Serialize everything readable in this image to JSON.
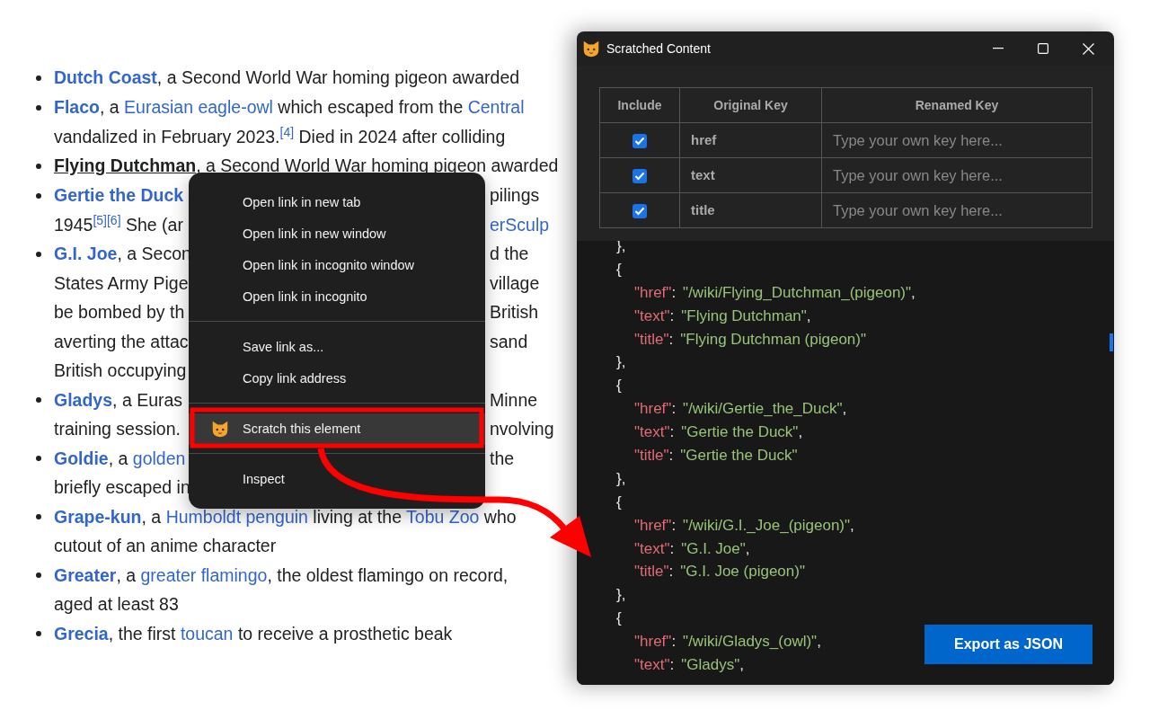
{
  "article": {
    "items": [
      {
        "lines": [
          {
            "segments": [
              {
                "text": "Dutch Coast",
                "kind": "bold_link"
              },
              {
                "text": ", a Second World War homing pigeon awarded",
                "kind": "plain"
              }
            ]
          }
        ]
      },
      {
        "lines": [
          {
            "segments": [
              {
                "text": "Flaco",
                "kind": "bold_link"
              },
              {
                "text": ", a ",
                "kind": "plain"
              },
              {
                "text": "Eurasian eagle-owl",
                "kind": "link"
              },
              {
                "text": " which escaped from the ",
                "kind": "plain"
              },
              {
                "text": "Central",
                "kind": "link"
              }
            ]
          },
          {
            "segments": [
              {
                "text": "vandalized in February 2023.",
                "kind": "plain"
              },
              {
                "text": "[4]",
                "kind": "ref"
              },
              {
                "text": " Died in 2024 after colliding",
                "kind": "plain"
              }
            ]
          }
        ]
      },
      {
        "lines": [
          {
            "segments": [
              {
                "text": "Flying Dutchman",
                "kind": "visited_bold_link"
              },
              {
                "text": ", a Second World War homing pigeon awarded",
                "kind": "plain"
              }
            ]
          }
        ]
      },
      {
        "lines": [
          {
            "segments": [
              {
                "text": "Gertie the Duck",
                "kind": "bold_link"
              }
            ],
            "after_menu": [
              {
                "text": "pilings",
                "kind": "plain"
              }
            ]
          },
          {
            "segments": [
              {
                "text": "1945",
                "kind": "plain"
              },
              {
                "text": "[5][6]",
                "kind": "ref"
              },
              {
                "text": " She (ar",
                "kind": "plain"
              }
            ],
            "after_menu": [
              {
                "text": "erSculp",
                "kind": "link"
              }
            ]
          }
        ]
      },
      {
        "lines": [
          {
            "segments": [
              {
                "text": "G.I. Joe",
                "kind": "bold_link"
              },
              {
                "text": ", a Secon",
                "kind": "plain"
              }
            ],
            "after_menu": [
              {
                "text": "d the",
                "kind": "plain"
              }
            ]
          },
          {
            "segments": [
              {
                "text": "States Army Pige",
                "kind": "plain"
              }
            ],
            "after_menu": [
              {
                "text": "village",
                "kind": "plain"
              }
            ]
          },
          {
            "segments": [
              {
                "text": "be bombed by th",
                "kind": "plain"
              }
            ],
            "after_menu": [
              {
                "text": "British",
                "kind": "plain"
              }
            ]
          },
          {
            "segments": [
              {
                "text": "averting the attac",
                "kind": "plain"
              }
            ],
            "after_menu": [
              {
                "text": "sand",
                "kind": "plain"
              }
            ]
          },
          {
            "segments": [
              {
                "text": "British occupying",
                "kind": "plain"
              }
            ]
          }
        ]
      },
      {
        "lines": [
          {
            "segments": [
              {
                "text": "Gladys",
                "kind": "bold_link"
              },
              {
                "text": ", a Euras",
                "kind": "plain"
              }
            ],
            "after_menu": [
              {
                "text": "Minne",
                "kind": "plain"
              }
            ]
          },
          {
            "segments": [
              {
                "text": "training session.",
                "kind": "plain"
              }
            ],
            "after_menu": [
              {
                "text": "nvolving",
                "kind": "plain"
              }
            ]
          }
        ]
      },
      {
        "lines": [
          {
            "segments": [
              {
                "text": "Goldie",
                "kind": "bold_link"
              },
              {
                "text": ", a ",
                "kind": "plain"
              },
              {
                "text": "golden",
                "kind": "link"
              }
            ],
            "after_menu": [
              {
                "text": "the",
                "kind": "plain"
              }
            ]
          },
          {
            "segments": [
              {
                "text": "briefly escaped in",
                "kind": "plain"
              }
            ]
          }
        ]
      },
      {
        "lines": [
          {
            "segments": [
              {
                "text": "Grape-kun",
                "kind": "bold_link"
              },
              {
                "text": ", a ",
                "kind": "plain"
              },
              {
                "text": "Humboldt penguin",
                "kind": "link"
              },
              {
                "text": " living at the ",
                "kind": "plain"
              },
              {
                "text": "Tobu Zoo",
                "kind": "link"
              },
              {
                "text": " who",
                "kind": "plain"
              }
            ]
          },
          {
            "segments": [
              {
                "text": "cutout of an anime character",
                "kind": "plain"
              }
            ]
          }
        ]
      },
      {
        "lines": [
          {
            "segments": [
              {
                "text": "Greater",
                "kind": "bold_link"
              },
              {
                "text": ", a ",
                "kind": "plain"
              },
              {
                "text": "greater flamingo",
                "kind": "link"
              },
              {
                "text": ", the oldest flamingo on record,",
                "kind": "plain"
              }
            ]
          },
          {
            "segments": [
              {
                "text": "aged at least 83",
                "kind": "plain"
              }
            ]
          }
        ]
      },
      {
        "lines": [
          {
            "segments": [
              {
                "text": "Grecia",
                "kind": "bold_link"
              },
              {
                "text": ", the first ",
                "kind": "plain"
              },
              {
                "text": "toucan",
                "kind": "link"
              },
              {
                "text": " to receive a prosthetic beak",
                "kind": "plain"
              }
            ]
          }
        ]
      }
    ]
  },
  "context_menu": {
    "items": [
      {
        "kind": "item",
        "label": "Open link in new tab",
        "selected": false
      },
      {
        "kind": "item",
        "label": "Open link in new window",
        "selected": false
      },
      {
        "kind": "item",
        "label": "Open link in incognito window",
        "selected": false
      },
      {
        "kind": "item",
        "label": "Open link in incognito",
        "selected": false
      },
      {
        "kind": "separator"
      },
      {
        "kind": "item",
        "label": "Save link as...",
        "selected": false
      },
      {
        "kind": "item",
        "label": "Copy link address",
        "selected": false
      },
      {
        "kind": "separator"
      },
      {
        "kind": "extension_item",
        "label": "Scratch this element",
        "selected": true
      },
      {
        "kind": "separator"
      },
      {
        "kind": "item",
        "label": "Inspect",
        "selected": false
      }
    ]
  },
  "window": {
    "title": "Scratched Content",
    "table": {
      "columns": [
        "Include",
        "Original Key",
        "Renamed Key"
      ],
      "rows": [
        {
          "checked": true,
          "key": "href",
          "placeholder": "Type your own key here..."
        },
        {
          "checked": true,
          "key": "text",
          "placeholder": "Type your own key here..."
        },
        {
          "checked": true,
          "key": "title",
          "placeholder": "Type your own key here..."
        }
      ]
    },
    "code_lines": [
      {
        "tokens": [
          {
            "text": "},",
            "kind": "punct"
          }
        ]
      },
      {
        "tokens": [
          {
            "text": "{",
            "kind": "punct"
          }
        ],
        "children": [
          {
            "tokens": [
              {
                "text": "\"href\"",
                "kind": "key"
              },
              {
                "text": ":",
                "kind": "punct"
              },
              {
                "text": "\"/wiki/Flying_Dutchman_(pigeon)\"",
                "kind": "string"
              },
              {
                "text": ",",
                "kind": "punct"
              }
            ]
          },
          {
            "tokens": [
              {
                "text": "\"text\"",
                "kind": "key"
              },
              {
                "text": ":",
                "kind": "punct"
              },
              {
                "text": "\"Flying Dutchman\"",
                "kind": "string"
              },
              {
                "text": ",",
                "kind": "punct"
              }
            ]
          },
          {
            "tokens": [
              {
                "text": "\"title\"",
                "kind": "key"
              },
              {
                "text": ":",
                "kind": "punct"
              },
              {
                "text": "\"Flying Dutchman (pigeon)\"",
                "kind": "string"
              }
            ]
          }
        ]
      },
      {
        "tokens": [
          {
            "text": "},",
            "kind": "punct"
          }
        ]
      },
      {
        "tokens": [
          {
            "text": "{",
            "kind": "punct"
          }
        ],
        "children": [
          {
            "tokens": [
              {
                "text": "\"href\"",
                "kind": "key"
              },
              {
                "text": ":",
                "kind": "punct"
              },
              {
                "text": "\"/wiki/Gertie_the_Duck\"",
                "kind": "string"
              },
              {
                "text": ",",
                "kind": "punct"
              }
            ]
          },
          {
            "tokens": [
              {
                "text": "\"text\"",
                "kind": "key"
              },
              {
                "text": ":",
                "kind": "punct"
              },
              {
                "text": "\"Gertie the Duck\"",
                "kind": "string"
              },
              {
                "text": ",",
                "kind": "punct"
              }
            ]
          },
          {
            "tokens": [
              {
                "text": "\"title\"",
                "kind": "key"
              },
              {
                "text": ":",
                "kind": "punct"
              },
              {
                "text": "\"Gertie the Duck\"",
                "kind": "string"
              }
            ]
          }
        ]
      },
      {
        "tokens": [
          {
            "text": "},",
            "kind": "punct"
          }
        ]
      },
      {
        "tokens": [
          {
            "text": "{",
            "kind": "punct"
          }
        ],
        "children": [
          {
            "tokens": [
              {
                "text": "\"href\"",
                "kind": "key"
              },
              {
                "text": ":",
                "kind": "punct"
              },
              {
                "text": "\"/wiki/G.I._Joe_(pigeon)\"",
                "kind": "string"
              },
              {
                "text": ",",
                "kind": "punct"
              }
            ]
          },
          {
            "tokens": [
              {
                "text": "\"text\"",
                "kind": "key"
              },
              {
                "text": ":",
                "kind": "punct"
              },
              {
                "text": "\"G.I. Joe\"",
                "kind": "string"
              },
              {
                "text": ",",
                "kind": "punct"
              }
            ]
          },
          {
            "tokens": [
              {
                "text": "\"title\"",
                "kind": "key"
              },
              {
                "text": ":",
                "kind": "punct"
              },
              {
                "text": "\"G.I. Joe (pigeon)\"",
                "kind": "string"
              }
            ]
          }
        ]
      },
      {
        "tokens": [
          {
            "text": "},",
            "kind": "punct"
          }
        ]
      },
      {
        "tokens": [
          {
            "text": "{",
            "kind": "punct"
          }
        ],
        "children": [
          {
            "tokens": [
              {
                "text": "\"href\"",
                "kind": "key"
              },
              {
                "text": ":",
                "kind": "punct"
              },
              {
                "text": "\"/wiki/Gladys_(owl)\"",
                "kind": "string"
              },
              {
                "text": ",",
                "kind": "punct"
              }
            ]
          },
          {
            "tokens": [
              {
                "text": "\"text\"",
                "kind": "key"
              },
              {
                "text": ":",
                "kind": "punct"
              },
              {
                "text": "\"Gladys\"",
                "kind": "string"
              },
              {
                "text": ",",
                "kind": "punct"
              }
            ]
          }
        ]
      }
    ],
    "export_button": "Export as JSON"
  }
}
